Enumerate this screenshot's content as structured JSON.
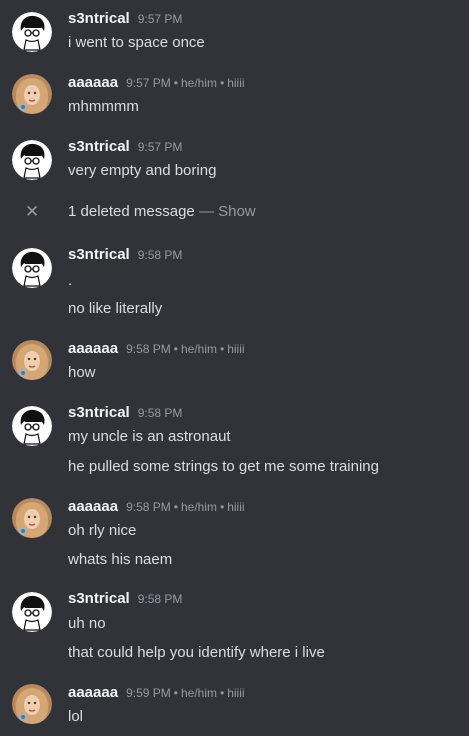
{
  "messages": [
    {
      "user": "s3ntrical",
      "time": "9:57 PM",
      "lines": [
        "i went to space once"
      ]
    },
    {
      "user": "aaaaaa",
      "time": "9:57 PM",
      "pronouns": "he/him",
      "extra": "hiiii",
      "lines": [
        "mhmmmm"
      ]
    },
    {
      "user": "s3ntrical",
      "time": "9:57 PM",
      "lines": [
        "very empty and boring"
      ]
    },
    {
      "user": "s3ntrical",
      "time": "9:58 PM",
      "lines": [
        ".",
        "no like literally"
      ]
    },
    {
      "user": "aaaaaa",
      "time": "9:58 PM",
      "pronouns": "he/him",
      "extra": "hiiii",
      "lines": [
        "how"
      ]
    },
    {
      "user": "s3ntrical",
      "time": "9:58 PM",
      "lines": [
        "my uncle is an astronaut",
        "he pulled some strings to get me some training"
      ]
    },
    {
      "user": "aaaaaa",
      "time": "9:58 PM",
      "pronouns": "he/him",
      "extra": "hiiii",
      "lines": [
        "oh rly nice",
        "whats his naem"
      ]
    },
    {
      "user": "s3ntrical",
      "time": "9:58 PM",
      "lines": [
        "uh no",
        "that could help you identify where i live"
      ]
    },
    {
      "user": "aaaaaa",
      "time": "9:59 PM",
      "pronouns": "he/him",
      "extra": "hiiii",
      "lines": [
        "lol"
      ]
    }
  ],
  "deleted": {
    "count_text": "1 deleted message",
    "separator": "—",
    "show_label": "Show",
    "icon": "close-icon"
  },
  "pronoun_separator": "•",
  "avatars": {
    "s3ntrical": "sketch-avatar",
    "aaaaaa": "portrait-avatar"
  },
  "colors": {
    "background": "#313338",
    "username": "#f2f3f5",
    "text": "#dbdee1",
    "muted": "#949ba4"
  }
}
